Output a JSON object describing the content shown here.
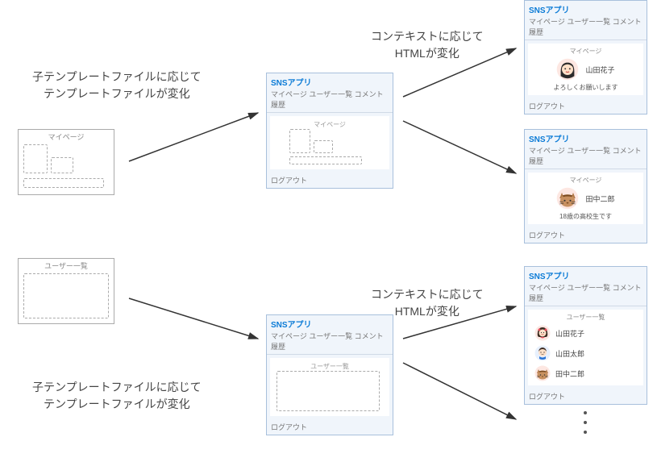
{
  "annotations": {
    "left_top": "子テンプレートファイルに応じて\nテンプレートファイルが変化",
    "left_bot": "子テンプレートファイルに応じて\nテンプレートファイルが変化",
    "right_top": "コンテキストに応じて\nHTMLが変化",
    "right_bot": "コンテキストに応じて\nHTMLが変化"
  },
  "skeleton": {
    "mypage_label": "マイページ",
    "userlist_label": "ユーザー一覧"
  },
  "card": {
    "app_title": "SNSアプリ",
    "nav": "マイページ ユーザー一覧 コメント履歴",
    "logout": "ログアウト",
    "mypage": "マイページ",
    "userlist": "ユーザー一覧"
  },
  "profiles": {
    "hanako": {
      "name": "山田花子",
      "bio": "よろしくお願いします"
    },
    "tanaka": {
      "name": "田中二郎",
      "bio": "18歳の高校生です"
    },
    "taro": {
      "name": "山田太郎"
    }
  }
}
